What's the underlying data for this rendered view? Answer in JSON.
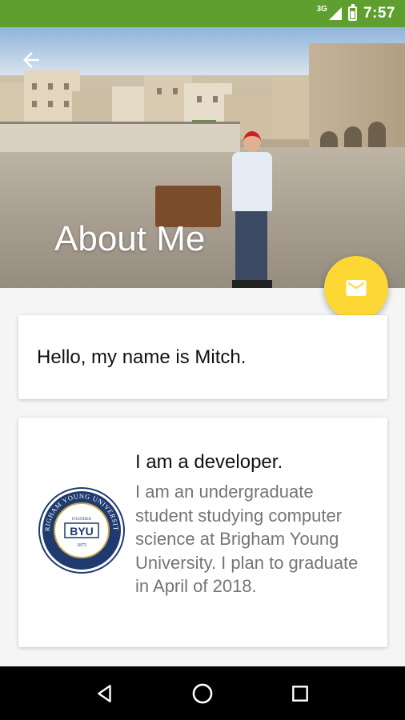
{
  "status_bar": {
    "network": "3G",
    "time": "7:57"
  },
  "header": {
    "title": "About Me",
    "back_icon": "back-arrow-icon"
  },
  "fab": {
    "icon": "email-icon",
    "color": "#fdd835"
  },
  "cards": {
    "hello": {
      "text": "Hello, my name is Mitch."
    },
    "developer": {
      "heading": "I am a developer.",
      "body": "I am an undergraduate student studying computer science at Brigham Young University. I plan to graduate in April of 2018.",
      "logo": {
        "name": "byu-seal",
        "ring_text_top": "BRIGHAM YOUNG UNIVERSITY",
        "ring_text_bottom": "PROVO, UTAH",
        "founded": "FOUNDED",
        "center": "BYU",
        "year": "1875"
      }
    }
  },
  "colors": {
    "status_bar": "#5f9f2f",
    "accent": "#fdd835",
    "body_text": "#757575"
  }
}
